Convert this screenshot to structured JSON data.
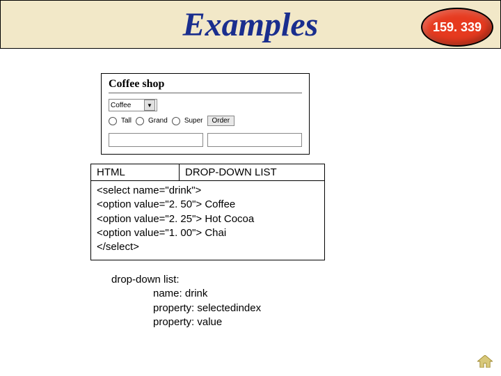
{
  "title": "Examples",
  "badge": "159. 339",
  "form": {
    "heading": "Coffee shop",
    "dropdown_value": "Coffee",
    "radios": [
      "Tall",
      "Grand",
      "Super"
    ],
    "order_label": "Order"
  },
  "code": {
    "header_left": "HTML",
    "header_right": "DROP-DOWN LIST",
    "lines": [
      "<select name=\"drink\">",
      "<option value=\"2. 50\"> Coffee",
      "<option value=\"2. 25\"> Hot Cocoa",
      "<option value=\"1. 00\"> Chai",
      "</select>"
    ]
  },
  "notes": {
    "line1": "drop-down list:",
    "line2": "name: drink",
    "line3": "property: selectedindex",
    "line4": "property: value"
  }
}
